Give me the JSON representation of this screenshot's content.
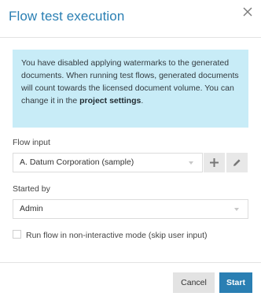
{
  "dialog": {
    "title": "Flow test execution",
    "close_icon": "close-icon"
  },
  "info": {
    "text_before": "You have disabled applying watermarks to the generated documents. When running test flows, generated documents will count towards the licensed document volume. You can change it in the ",
    "link_text": "project settings",
    "text_after": "."
  },
  "flow_input": {
    "label": "Flow input",
    "selected": "A. Datum Corporation (sample)",
    "add_icon": "plus-icon",
    "edit_icon": "pencil-icon"
  },
  "started_by": {
    "label": "Started by",
    "selected": "Admin"
  },
  "non_interactive": {
    "label": "Run flow in non-interactive mode (skip user input)",
    "checked": false
  },
  "footer": {
    "cancel_label": "Cancel",
    "start_label": "Start"
  },
  "colors": {
    "accent": "#2a7fb3",
    "info_background": "#c8ecf7"
  }
}
